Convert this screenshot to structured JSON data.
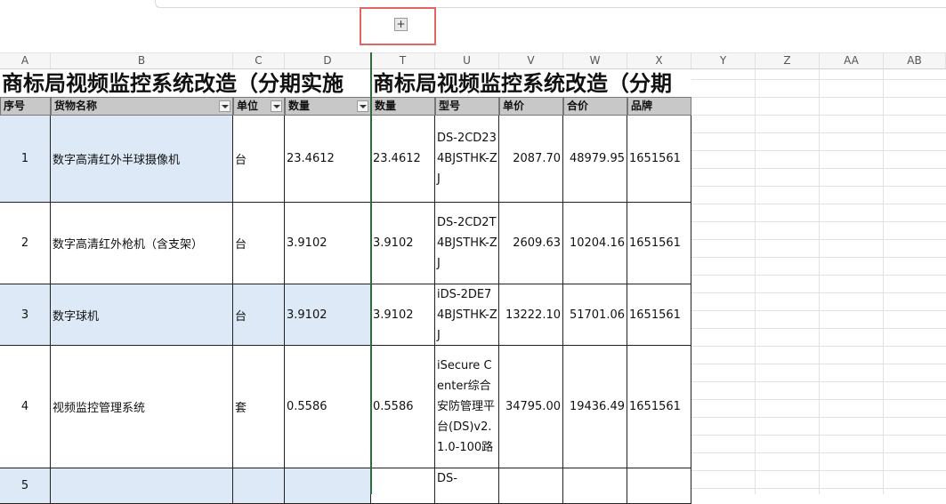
{
  "toolbar": {
    "expand_icon": "plus-box-icon",
    "expand_label": "+"
  },
  "columns": [
    "A",
    "B",
    "C",
    "D",
    "T",
    "U",
    "V",
    "W",
    "X",
    "Y",
    "Z",
    "AA",
    "AB"
  ],
  "title": {
    "left": "商标局视频监控系统改造（分期实施",
    "right": "商标局视频监控系统改造（分期"
  },
  "headers": [
    "序号",
    "货物名称",
    "单位",
    "数量",
    "数量",
    "型号",
    "单价",
    "合价",
    "品牌"
  ],
  "rows": [
    {
      "seq": "1",
      "name": "数字高清红外半球摄像机",
      "unit": "台",
      "qty": "23.4612",
      "qty2": "23.4612",
      "model": "DS-2CD234BJSTHK-ZJ",
      "price": "2087.70",
      "total": "48979.95",
      "brand": "1651561"
    },
    {
      "seq": "2",
      "name": "数字高清红外枪机（含支架）",
      "unit": "台",
      "qty": "3.9102",
      "qty2": "3.9102",
      "model": "DS-2CD2T4BJSTHK-ZJ",
      "price": "2609.63",
      "total": "10204.16",
      "brand": "1651561"
    },
    {
      "seq": "3",
      "name": "数字球机",
      "unit": "台",
      "qty": "3.9102",
      "qty2": "3.9102",
      "model": "iDS-2DE74BJSTHK-ZJ",
      "price": "13222.10",
      "total": "51701.06",
      "brand": "1651561"
    },
    {
      "seq": "4",
      "name": "视频监控管理系统",
      "unit": "套",
      "qty": "0.5586",
      "qty2": "0.5586",
      "model": "iSecure Center综合安防管理平台(DS)v2.1.0-100路",
      "price": "34795.00",
      "total": "19436.49",
      "brand": "1651561"
    },
    {
      "seq": "5",
      "name": "",
      "unit": "",
      "qty": "",
      "qty2": "",
      "model": "DS-",
      "price": "",
      "total": "",
      "brand": ""
    }
  ]
}
